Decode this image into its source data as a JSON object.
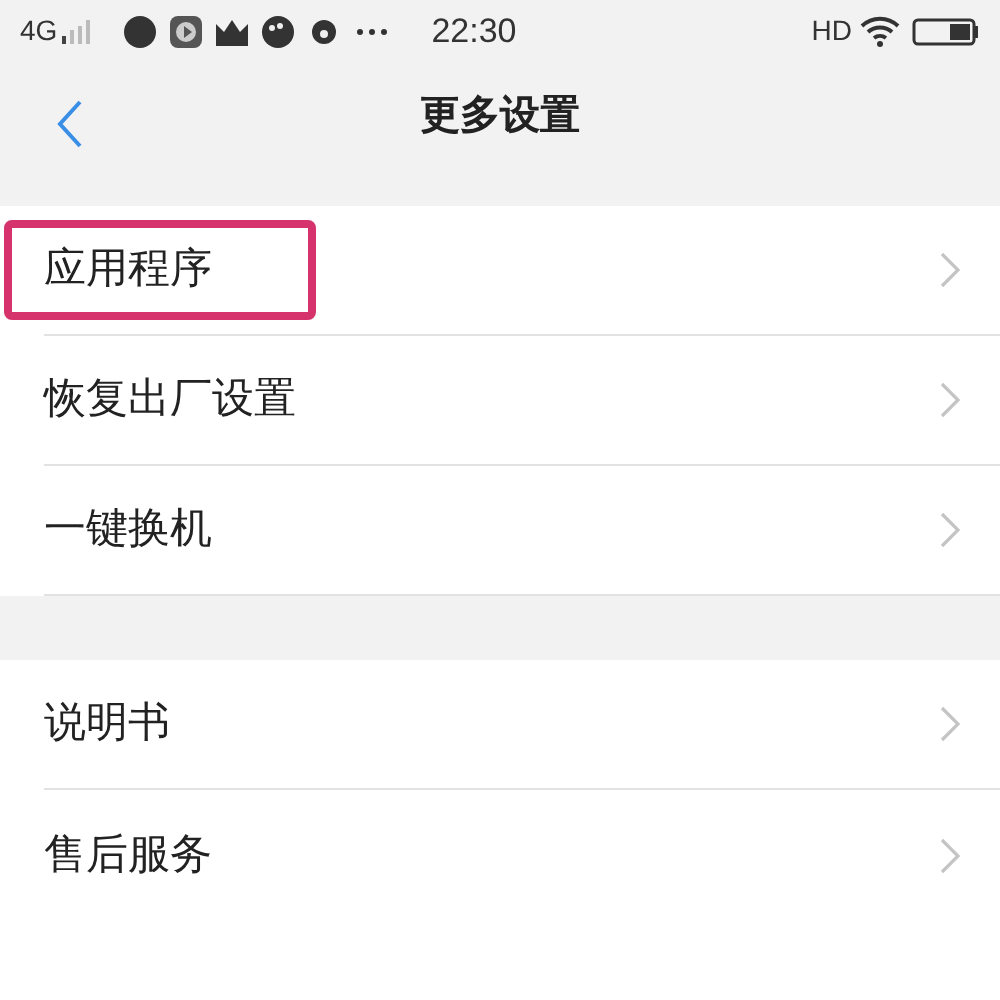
{
  "status_bar": {
    "network": "4G",
    "time": "22:30",
    "hd": "HD"
  },
  "header": {
    "title": "更多设置"
  },
  "groups": [
    {
      "items": [
        {
          "label": "应用程序",
          "highlighted": true
        },
        {
          "label": "恢复出厂设置",
          "highlighted": false
        },
        {
          "label": "一键换机",
          "highlighted": false
        }
      ]
    },
    {
      "items": [
        {
          "label": "说明书",
          "highlighted": false
        },
        {
          "label": "售后服务",
          "highlighted": false
        }
      ]
    }
  ]
}
